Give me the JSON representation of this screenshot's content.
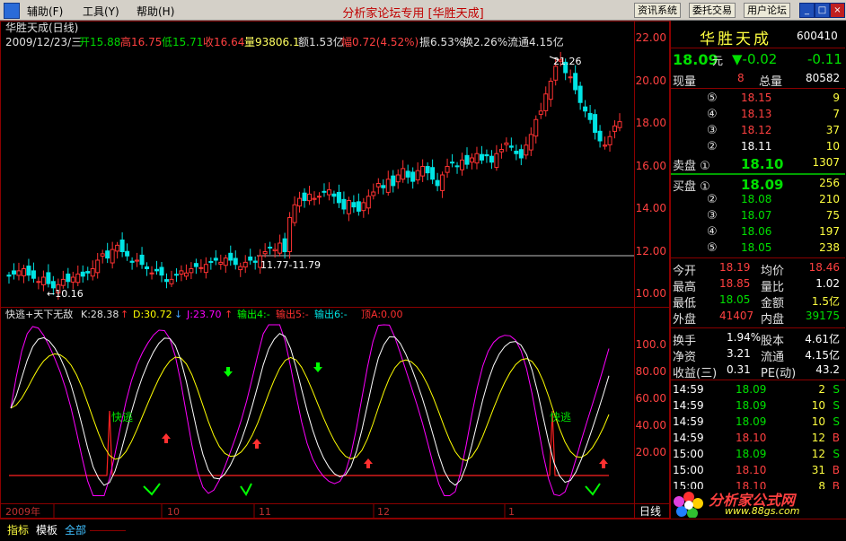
{
  "menu": {
    "assist": "辅助(F)",
    "tools": "工具(Y)",
    "help": "帮助(H)",
    "title_center": "分析家论坛专用 [华胜天成]",
    "btn_trade": "资讯系统",
    "btn_entrust": "委托交易",
    "btn_forum": "用户论坛",
    "win_min": "_",
    "win_restore": "□",
    "win_close": "×"
  },
  "chart_header": {
    "title": "华胜天成(日线)",
    "date": "2009/12/23/三",
    "open": "开15.88",
    "high": "高16.75",
    "low": "低15.71",
    "close": "收16.64",
    "volume": "量93806.1",
    "amount": "额1.53亿",
    "change": "幅0.72(4.52%)",
    "amplitude": "振6.53%",
    "turnover": "换2.26%",
    "float_cap": "流通4.15亿"
  },
  "price_axis": [
    "22.00",
    "20.00",
    "18.00",
    "16.00",
    "14.00",
    "12.00",
    "10.00"
  ],
  "annotations": {
    "high_mark": "21.26",
    "low_mark": "←10.16",
    "line_label": "11.77-11.79"
  },
  "indicator_header": {
    "name": "快逃+天下无敌",
    "k": "K:28.38",
    "k_arrow": "↑",
    "d": "D:30.72",
    "d_arrow": "↓",
    "j": "J:23.70",
    "j_arrow": "↑",
    "out4": "输出4:-",
    "out5": "输出5:-",
    "out6": "输出6:-",
    "top": "顶A:0.00"
  },
  "indicator_axis": [
    "100.0",
    "80.00",
    "60.00",
    "40.00",
    "20.00"
  ],
  "indicator_signals": [
    "快逃",
    "快逃"
  ],
  "time_axis": {
    "labels": [
      "2009年",
      "10",
      "11",
      "12",
      "1"
    ],
    "period": "日线"
  },
  "quote": {
    "name": "华胜天成",
    "code": "600410",
    "price": "18.09",
    "price_unit": "元",
    "change": "▼-0.02",
    "change2": "-0.11",
    "cur_vol_label": "现量",
    "cur_vol": "8",
    "total_vol_label": "总量",
    "total_vol": "80582",
    "sell": [
      {
        "lv": "⑤",
        "price": "18.15",
        "vol": "9"
      },
      {
        "lv": "④",
        "price": "18.13",
        "vol": "7"
      },
      {
        "lv": "③",
        "price": "18.12",
        "vol": "37"
      },
      {
        "lv": "②",
        "price": "18.11",
        "vol": "10"
      },
      {
        "lv": "卖盘 ①",
        "price": "18.10",
        "vol": "1307"
      }
    ],
    "buy": [
      {
        "lv": "买盘 ①",
        "price": "18.09",
        "vol": "256"
      },
      {
        "lv": "②",
        "price": "18.08",
        "vol": "210"
      },
      {
        "lv": "③",
        "price": "18.07",
        "vol": "75"
      },
      {
        "lv": "④",
        "price": "18.06",
        "vol": "197"
      },
      {
        "lv": "⑤",
        "price": "18.05",
        "vol": "238"
      }
    ],
    "stats": [
      {
        "l1": "今开",
        "v1": "18.19",
        "l2": "均价",
        "v2": "18.46"
      },
      {
        "l1": "最高",
        "v1": "18.85",
        "l2": "量比",
        "v2": "1.02"
      },
      {
        "l1": "最低",
        "v1": "18.05",
        "l2": "金额",
        "v2": "1.5亿"
      },
      {
        "l1": "外盘",
        "v1": "41407",
        "l2": "内盘",
        "v2": "39175"
      }
    ],
    "fund": [
      {
        "l1": "换手",
        "v1": "1.94%",
        "l2": "股本",
        "v2": "4.61亿"
      },
      {
        "l1": "净资",
        "v1": "3.21",
        "l2": "流通",
        "v2": "4.15亿"
      },
      {
        "l1": "收益(三)",
        "v1": "0.31",
        "l2": "PE(动)",
        "v2": "43.2"
      }
    ],
    "ticks": [
      {
        "time": "14:59",
        "price": "18.09",
        "vol": "2",
        "bs": "S"
      },
      {
        "time": "14:59",
        "price": "18.09",
        "vol": "10",
        "bs": "S"
      },
      {
        "time": "14:59",
        "price": "18.09",
        "vol": "10",
        "bs": "S"
      },
      {
        "time": "14:59",
        "price": "18.10",
        "vol": "12",
        "bs": "B"
      },
      {
        "time": "15:00",
        "price": "18.09",
        "vol": "12",
        "bs": "S"
      },
      {
        "time": "15:00",
        "price": "18.10",
        "vol": "31",
        "bs": "B"
      },
      {
        "time": "15:00",
        "price": "18.10",
        "vol": "8",
        "bs": "B"
      }
    ],
    "watermark": "分析家公式网",
    "watermark_url": "www.88gs.com"
  },
  "tabs": [
    "指标",
    "模板",
    "全部"
  ],
  "colors": {
    "up": "#ff3232",
    "down": "#00e4e4",
    "k_line": "#ffffff",
    "d_line": "#ffff00",
    "j_line": "#ff00ff",
    "top_line": "#ff2020",
    "grid": "#8b0000"
  }
}
